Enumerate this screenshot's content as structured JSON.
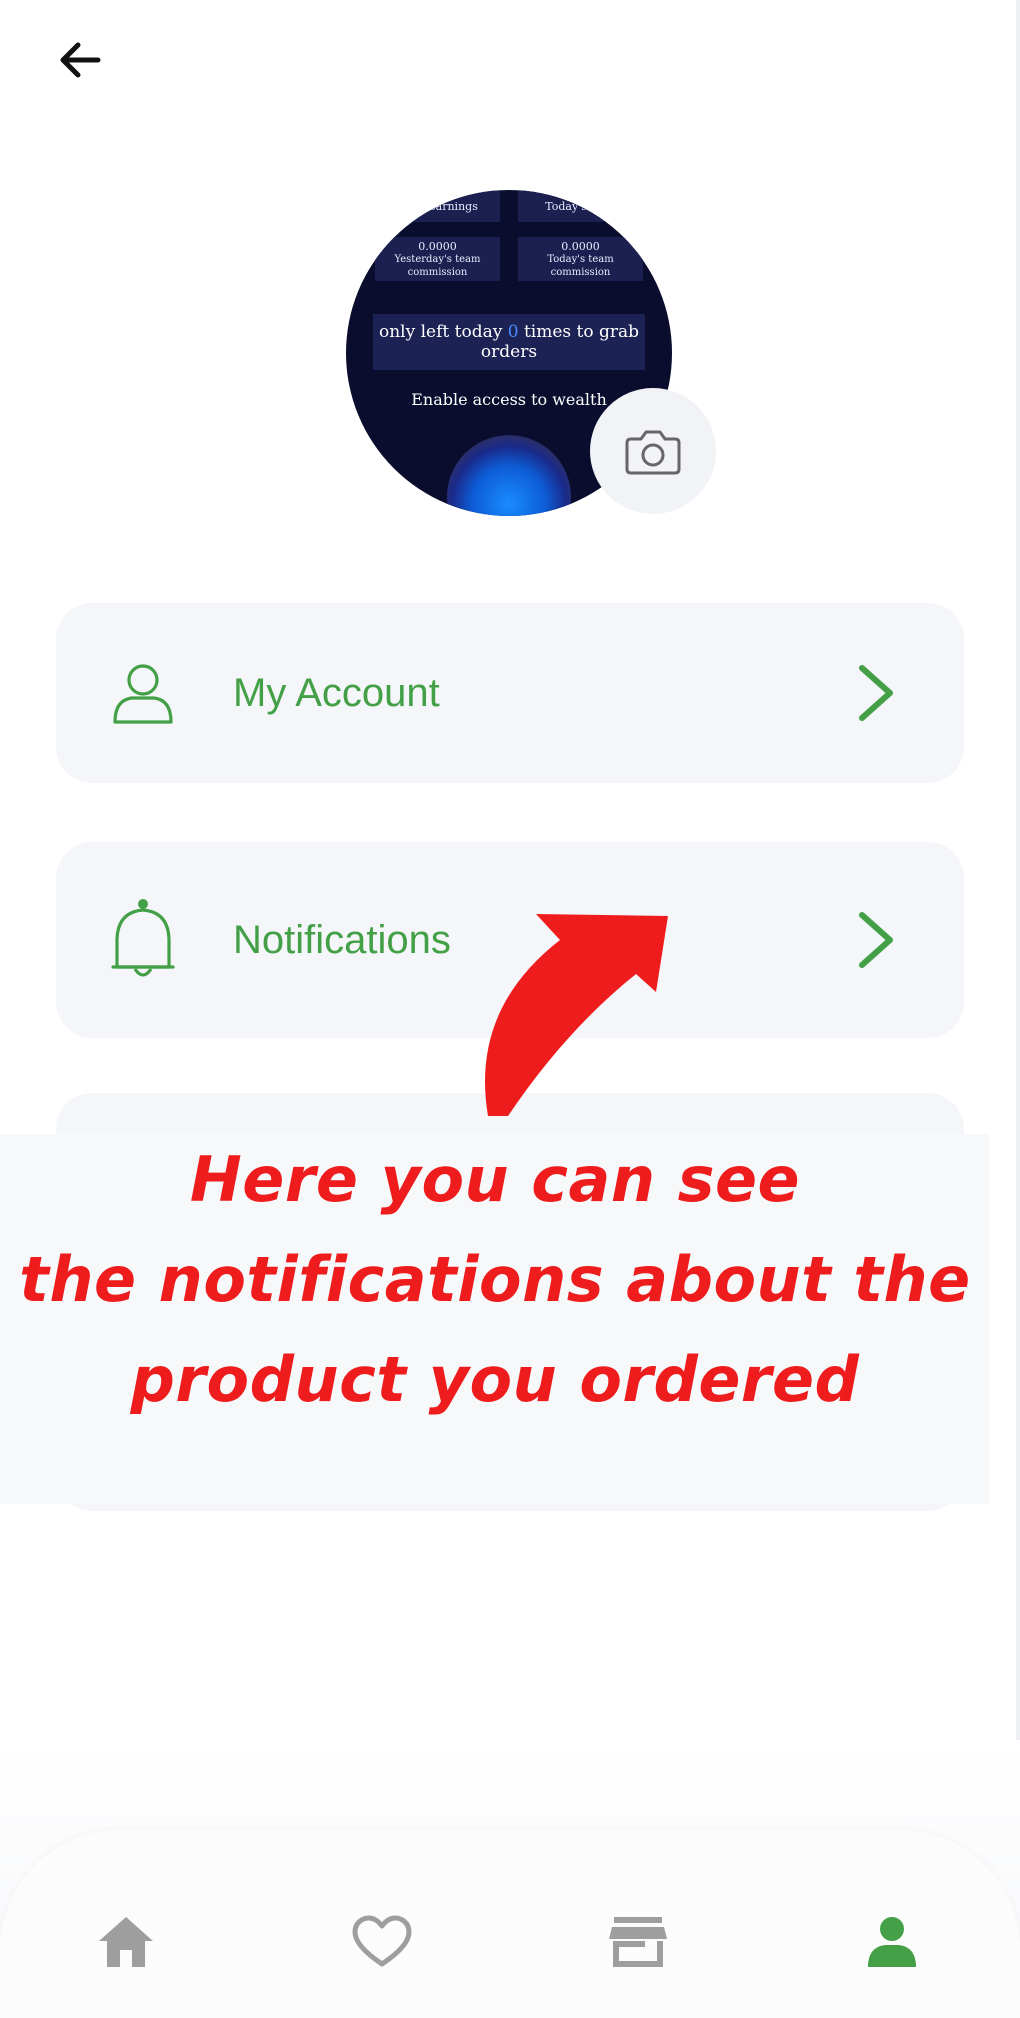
{
  "colors": {
    "accent": "#43a047",
    "annotation": "#ee1c1c",
    "card_bg": "#f5f6f9",
    "icon_gray": "#9e9e9e"
  },
  "header": {
    "back_icon": "arrow-left-icon"
  },
  "profile": {
    "camera_icon": "camera-icon",
    "photo": {
      "box1": "day's earnings",
      "box2": "Today's earn",
      "box3_value": "0.0000",
      "box3_label": "Yesterday's team commission",
      "box4_value": "0.0000",
      "box4_label": "Today's team commission",
      "banner_pre": "only left today ",
      "banner_num": "0",
      "banner_post": " times to grab orders",
      "wealth": "Enable access to wealth"
    }
  },
  "menu": [
    {
      "label": "My Account",
      "icon": "user-icon",
      "chevron": "chevron-right-icon"
    },
    {
      "label": "Notifications",
      "icon": "bell-icon",
      "chevron": "chevron-right-icon"
    }
  ],
  "annotation": {
    "line1": "Here you can see",
    "line2": "the notifications about the",
    "line3": "product you ordered"
  },
  "bottom_nav": [
    {
      "icon": "home-icon",
      "active": false
    },
    {
      "icon": "heart-icon",
      "active": false
    },
    {
      "icon": "store-icon",
      "active": false
    },
    {
      "icon": "profile-icon",
      "active": true
    }
  ]
}
